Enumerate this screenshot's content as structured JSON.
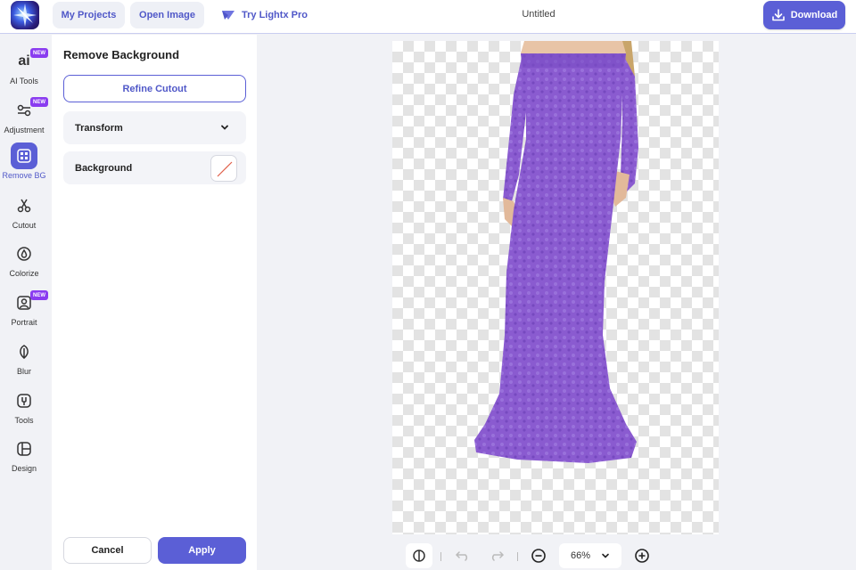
{
  "header": {
    "my_projects": "My Projects",
    "open_image": "Open Image",
    "try_pro": "Try Lightx Pro",
    "doc_title": "Untitled",
    "download": "Download"
  },
  "tools": [
    {
      "label": "AI Tools",
      "icon": "ai-icon",
      "badge": "NEW"
    },
    {
      "label": "Adjustment",
      "icon": "adjustment-icon",
      "badge": "NEW"
    },
    {
      "label": "Remove BG",
      "icon": "remove-bg-icon",
      "active": true
    },
    {
      "label": "Cutout",
      "icon": "scissors-icon"
    },
    {
      "label": "Colorize",
      "icon": "droplet-icon"
    },
    {
      "label": "Portrait",
      "icon": "portrait-icon",
      "badge": "NEW"
    },
    {
      "label": "Blur",
      "icon": "blur-leaf-icon"
    },
    {
      "label": "Tools",
      "icon": "tools-icon"
    },
    {
      "label": "Design",
      "icon": "design-icon"
    }
  ],
  "panel": {
    "title": "Remove Background",
    "refine": "Refine Cutout",
    "transform": "Transform",
    "background": "Background",
    "cancel": "Cancel",
    "apply": "Apply"
  },
  "bottom": {
    "zoom": "66%"
  },
  "colors": {
    "accent": "#5b5fd6",
    "badge": "#8a3cf0",
    "dress": "#8a5bd0"
  }
}
